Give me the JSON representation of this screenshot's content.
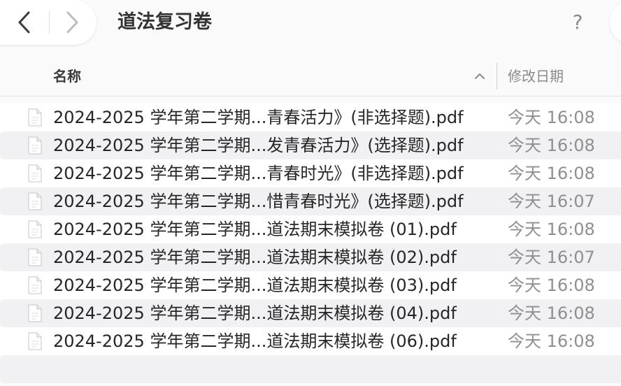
{
  "toolbar": {
    "title": "道法复习卷",
    "help_label": "?",
    "back_icon": "chevron-left-icon",
    "forward_icon": "chevron-right-icon"
  },
  "header": {
    "name_label": "名称",
    "date_label": "修改日期",
    "sort_icon": "chevron-up-icon"
  },
  "files": [
    {
      "name": "2024-2025 学年第二学期...青春活力》(非选择题).pdf",
      "date": "今天 16:08"
    },
    {
      "name": "2024-2025 学年第二学期...发青春活力》(选择题).pdf",
      "date": "今天 16:08"
    },
    {
      "name": "2024-2025 学年第二学期...青春时光》(非选择题).pdf",
      "date": "今天 16:08"
    },
    {
      "name": "2024-2025 学年第二学期...惜青春时光》(选择题).pdf",
      "date": "今天 16:07"
    },
    {
      "name": "2024-2025 学年第二学期...道法期末模拟卷 (01).pdf",
      "date": "今天 16:08"
    },
    {
      "name": "2024-2025 学年第二学期...道法期末模拟卷 (02).pdf",
      "date": "今天 16:07"
    },
    {
      "name": "2024-2025 学年第二学期...道法期末模拟卷 (03).pdf",
      "date": "今天 16:08"
    },
    {
      "name": "2024-2025 学年第二学期...道法期末模拟卷 (04).pdf",
      "date": "今天 16:08"
    },
    {
      "name": "2024-2025 学年第二学期...道法期末模拟卷 (06).pdf",
      "date": "今天 16:08"
    }
  ]
}
